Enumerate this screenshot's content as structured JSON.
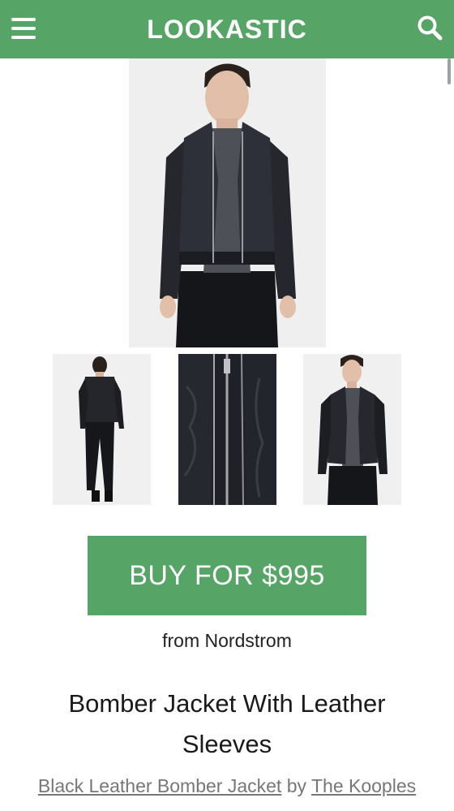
{
  "header": {
    "brand": "LOOKASTIC",
    "menu_icon": "hamburger-menu-icon",
    "search_icon": "search-icon",
    "background_color": "#56a566"
  },
  "gallery": {
    "main_image": "black-leather-bomber-jacket-front-photo",
    "thumbnails": [
      "jacket-back-view-photo",
      "jacket-zipper-detail-photo",
      "jacket-front-open-photo"
    ]
  },
  "purchase": {
    "button_label": "BUY FOR $995",
    "retailer_text": "from Nordstrom",
    "accent_color": "#56a566"
  },
  "product": {
    "title": "Bomber Jacket With Leather Sleeves",
    "category_link": "Black Leather Bomber Jacket",
    "by_text": "by",
    "brand_link": "The Kooples"
  }
}
